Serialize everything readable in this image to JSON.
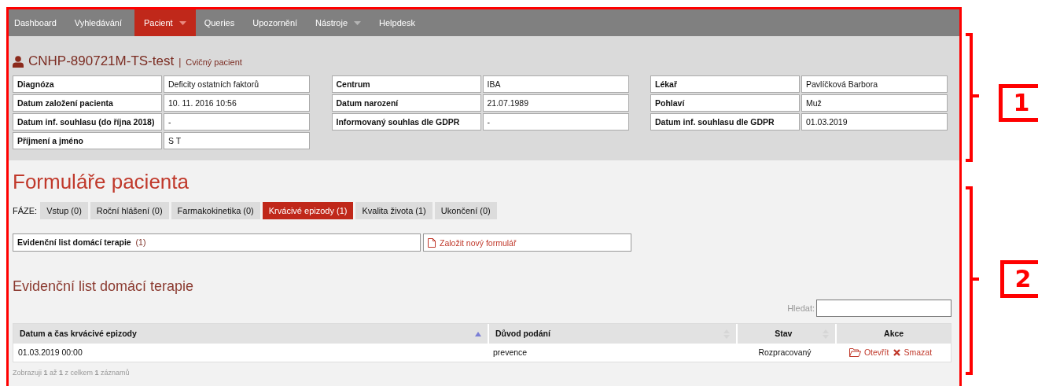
{
  "nav": [
    {
      "label": "Dashboard",
      "selected": false,
      "dropdown": false
    },
    {
      "label": "Vyhledávání",
      "selected": false,
      "dropdown": false
    },
    {
      "label": "Pacient",
      "selected": true,
      "dropdown": true
    },
    {
      "label": "Queries",
      "selected": false,
      "dropdown": false
    },
    {
      "label": "Upozornění",
      "selected": false,
      "dropdown": false
    },
    {
      "label": "Nástroje",
      "selected": false,
      "dropdown": true
    },
    {
      "label": "Helpdesk",
      "selected": false,
      "dropdown": false
    }
  ],
  "patient": {
    "id": "CNHP-890721M-TS-test",
    "separator": "|",
    "type": "Cvičný pacient"
  },
  "info_columns": [
    [
      {
        "label": "Diagnóza",
        "value": "Deficity ostatních faktorů"
      },
      {
        "label": "Datum založení pacienta",
        "value": "10. 11. 2016 10:56"
      },
      {
        "label": "Datum inf. souhlasu (do října 2018)",
        "value": "-"
      },
      {
        "label": "Příjmení a jméno",
        "value": "S T"
      }
    ],
    [
      {
        "label": "Centrum",
        "value": "IBA"
      },
      {
        "label": "Datum narození",
        "value": "21.07.1989"
      },
      {
        "label": "Informovaný souhlas dle GDPR",
        "value": "-"
      }
    ],
    [
      {
        "label": "Lékař",
        "value": "Pavlíčková Barbora"
      },
      {
        "label": "Pohlaví",
        "value": "Muž"
      },
      {
        "label": "Datum inf. souhlasu dle GDPR",
        "value": "01.03.2019"
      }
    ]
  ],
  "heading": "Formuláře pacienta",
  "phase_label": "FÁZE:",
  "phases": [
    {
      "label": "Vstup (0)",
      "selected": false
    },
    {
      "label": "Roční hlášení (0)",
      "selected": false
    },
    {
      "label": "Farmakokinetika (0)",
      "selected": false
    },
    {
      "label": "Krvácivé epizody (1)",
      "selected": true
    },
    {
      "label": "Kvalita života (1)",
      "selected": false
    },
    {
      "label": "Ukončení (0)",
      "selected": false
    }
  ],
  "form_row": {
    "name": "Evidenční list domácí terapie",
    "count": "(1)",
    "new_button": "Založit nový formulář"
  },
  "section_title": "Evidenční list domácí terapie",
  "search": {
    "label": "Hledat:"
  },
  "table": {
    "columns": [
      {
        "label": "Datum a čas krvácivé epizody",
        "sortable": true,
        "sorted": true
      },
      {
        "label": "Důvod podání",
        "sortable": true,
        "sorted": false
      },
      {
        "label": "Stav",
        "sortable": true,
        "sorted": false
      },
      {
        "label": "Akce",
        "sortable": false,
        "sorted": false
      }
    ],
    "rows": [
      {
        "cells": [
          "01.03.2019 00:00",
          "prevence",
          "Rozpracovaný"
        ],
        "actions": [
          {
            "label": "Otevřít",
            "kind": "open"
          },
          {
            "label": "Smazat",
            "kind": "delete"
          }
        ]
      }
    ]
  },
  "footer_info": "Zobrazuji **1** až **1** z celkem **1** záznamů",
  "annotations": [
    {
      "number": "1"
    },
    {
      "number": "2"
    }
  ]
}
